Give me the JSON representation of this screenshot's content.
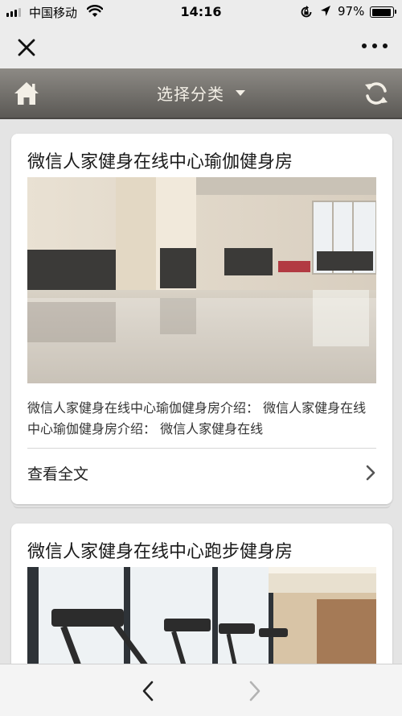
{
  "status_bar": {
    "carrier": "中国移动",
    "time": "14:16",
    "battery": "97%",
    "battery_level": 0.97,
    "icons": [
      "signal-icon",
      "wifi-icon",
      "orientation-lock-icon",
      "location-icon",
      "battery-icon"
    ]
  },
  "webview": {
    "icons": [
      "close-icon",
      "more-icon",
      "back-icon",
      "forward-icon"
    ]
  },
  "header": {
    "category_label": "选择分类",
    "icons": [
      "home-icon",
      "chevron-down-icon",
      "refresh-icon"
    ]
  },
  "articles": [
    {
      "title": "微信人家健身在线中心瑜伽健身房",
      "excerpt": "微信人家健身在线中心瑜伽健身房介绍： 微信人家健身在线中心瑜伽健身房介绍： 微信人家健身在线",
      "read_more": "查看全文"
    },
    {
      "title": "微信人家健身在线中心跑步健身房"
    }
  ],
  "colors": {
    "header_gradient_top": "#8d8a85",
    "header_gradient_bottom": "#5b5955",
    "header_text": "#f3efe6",
    "page_background": "#e4e4e4"
  }
}
